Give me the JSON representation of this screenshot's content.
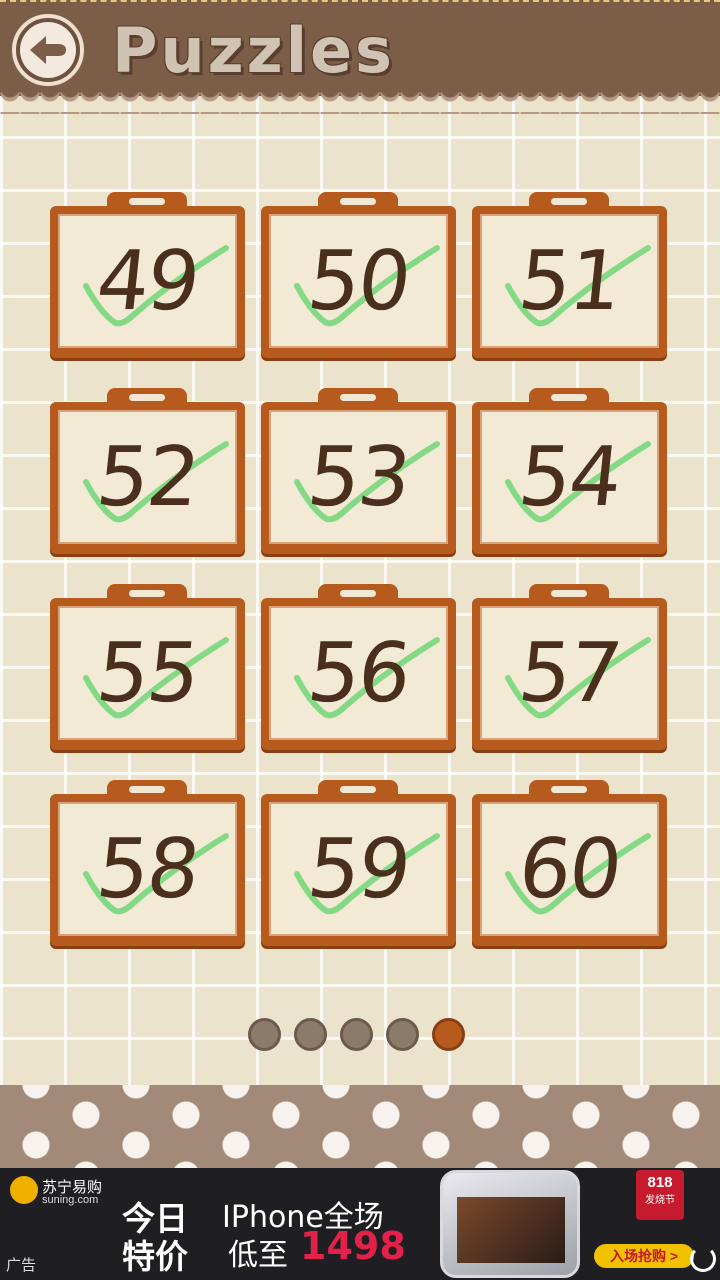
{
  "header": {
    "title": "Puzzles",
    "back_icon": "back-arrow-icon"
  },
  "puzzles": [
    {
      "number": "49",
      "completed": true
    },
    {
      "number": "50",
      "completed": true
    },
    {
      "number": "51",
      "completed": true
    },
    {
      "number": "52",
      "completed": true
    },
    {
      "number": "53",
      "completed": true
    },
    {
      "number": "54",
      "completed": true
    },
    {
      "number": "55",
      "completed": true
    },
    {
      "number": "56",
      "completed": true
    },
    {
      "number": "57",
      "completed": true
    },
    {
      "number": "58",
      "completed": true
    },
    {
      "number": "59",
      "completed": true
    },
    {
      "number": "60",
      "completed": true
    }
  ],
  "pagination": {
    "total_pages": 5,
    "current_page": 5
  },
  "ad": {
    "brand": "苏宁易购",
    "brand_url": "suning.com",
    "today": "今日",
    "special": "特价",
    "headline": "IPhone全场",
    "price_prefix": "低至",
    "price": "1498",
    "badge_number": "818",
    "badge_text": "发烧节",
    "enter_button": "入场抢购 >",
    "ad_label": "广告"
  },
  "colors": {
    "header_brown": "#7c5d48",
    "card_orange": "#b75a1d",
    "check_green": "#5fd36a",
    "number_brown": "#4a2f1d",
    "active_dot": "#b75a1d",
    "inactive_dot": "#8d7b6a",
    "price_red": "#e3214a"
  }
}
